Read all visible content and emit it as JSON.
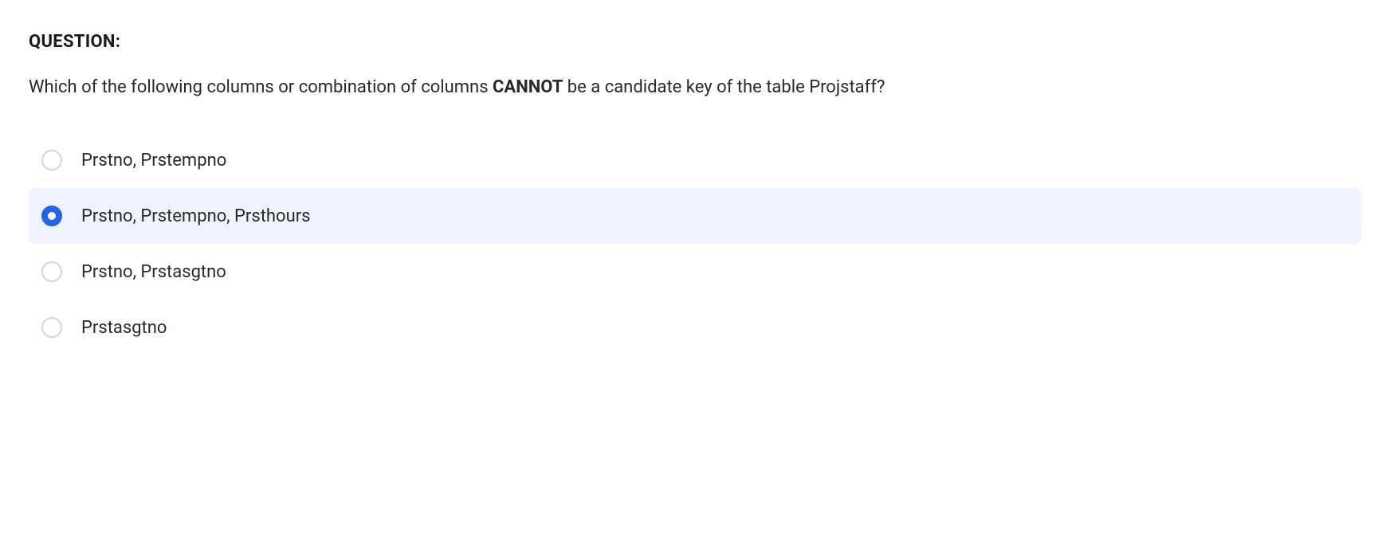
{
  "header": "QUESTION",
  "question_prefix": "Which of the following columns or combination of columns ",
  "question_bold": "CANNOT",
  "question_suffix": " be a candidate key of the table Projstaff?",
  "options": [
    {
      "label": "Prstno, Prstempno",
      "selected": false
    },
    {
      "label": "Prstno, Prstempno, Prsthours",
      "selected": true
    },
    {
      "label": "Prstno, Prstasgtno",
      "selected": false
    },
    {
      "label": "Prstasgtno",
      "selected": false
    }
  ]
}
